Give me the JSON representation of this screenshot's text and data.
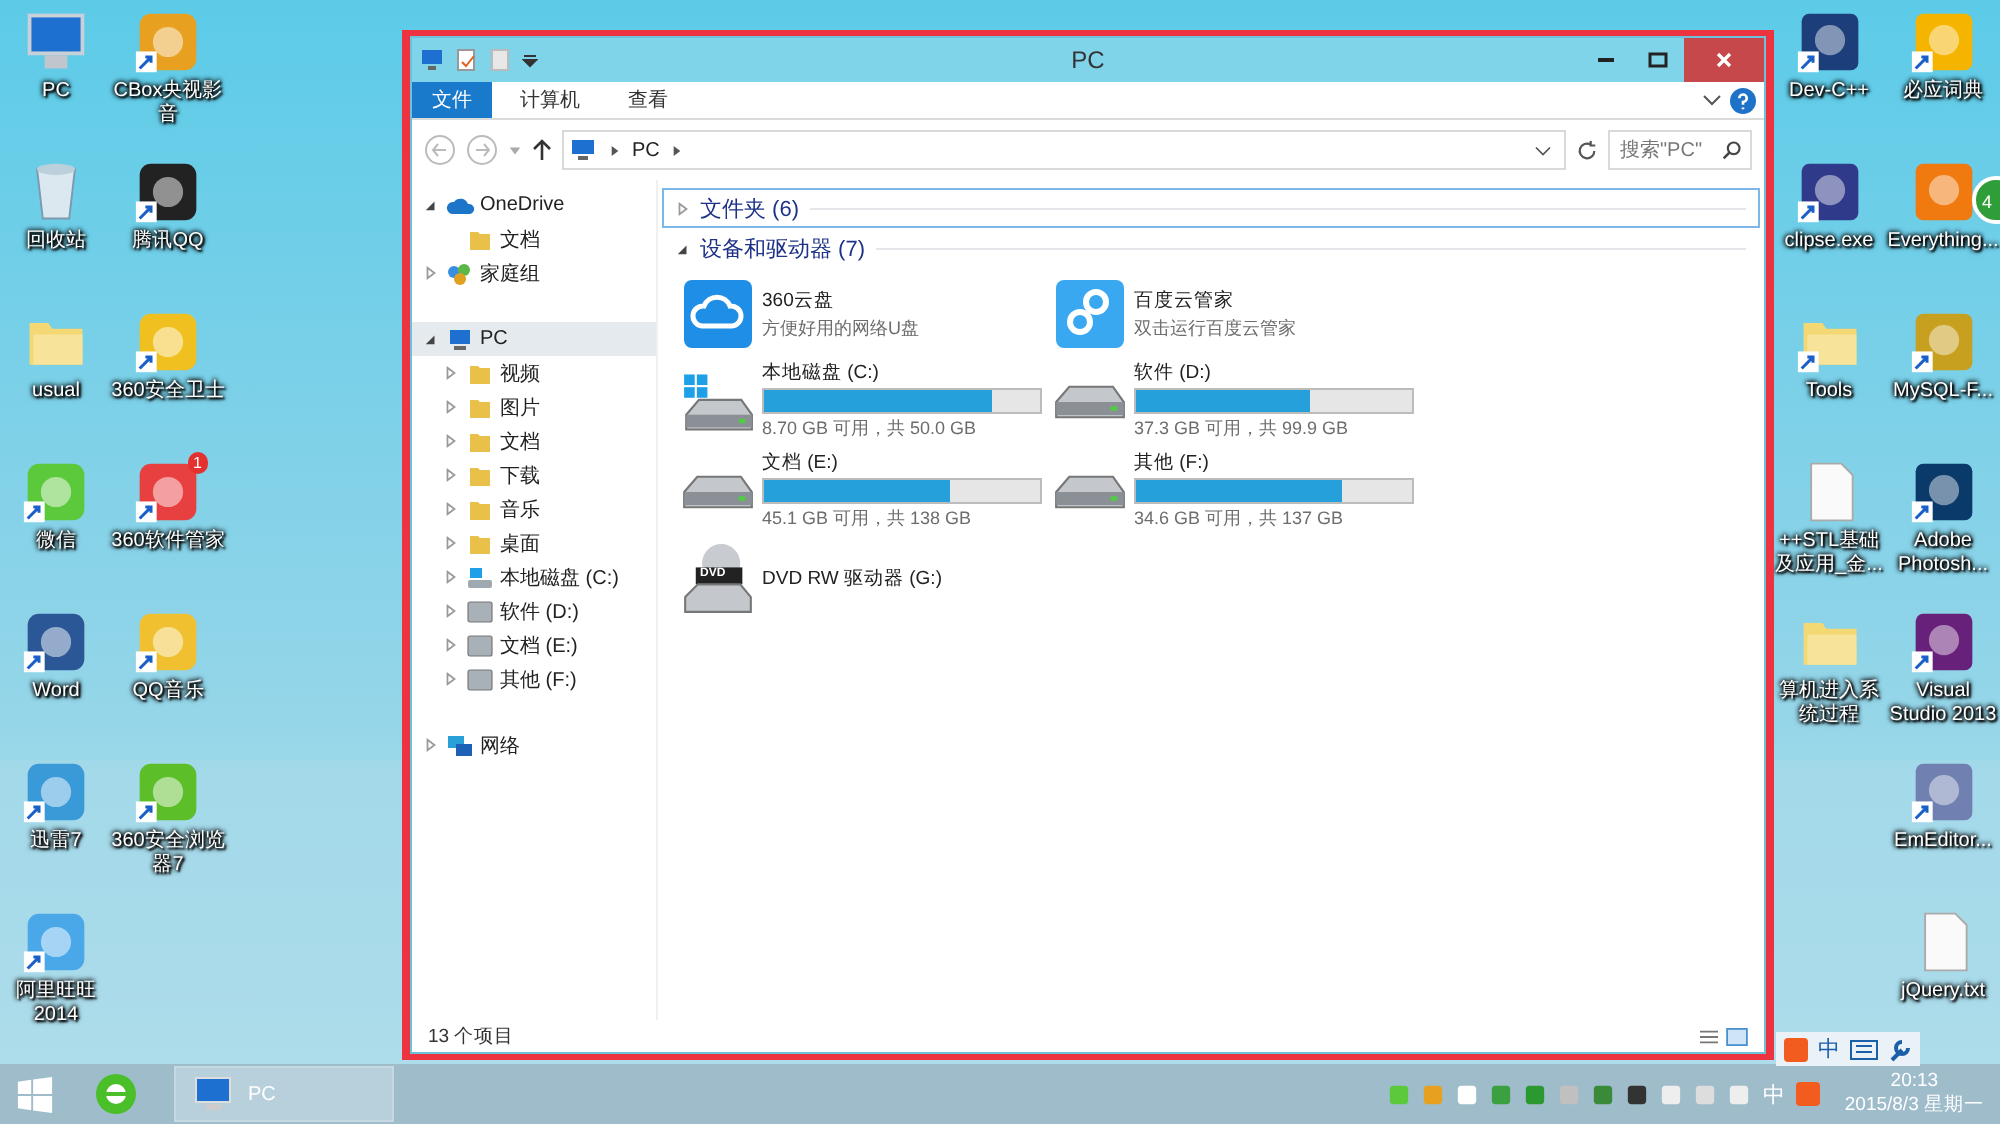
{
  "desktop": {
    "left_icons": [
      {
        "label": "PC",
        "kind": "pc",
        "shortcut": false
      },
      {
        "label": "回收站",
        "kind": "bin",
        "shortcut": false
      },
      {
        "label": "usual",
        "kind": "folder",
        "shortcut": false
      },
      {
        "label": "微信",
        "kind": "chat",
        "shortcut": true
      },
      {
        "label": "Word",
        "kind": "word",
        "shortcut": true
      },
      {
        "label": "迅雷7",
        "kind": "bird",
        "shortcut": true
      },
      {
        "label": "阿里旺旺2014",
        "kind": "bubble",
        "shortcut": true
      },
      {
        "label": "CBox央视影音",
        "kind": "video",
        "shortcut": true
      },
      {
        "label": "腾讯QQ",
        "kind": "penguin",
        "shortcut": true
      },
      {
        "label": "360安全卫士",
        "kind": "plus",
        "shortcut": true
      },
      {
        "label": "360软件管家",
        "kind": "grid",
        "shortcut": true,
        "badge": "1"
      },
      {
        "label": "QQ音乐",
        "kind": "music",
        "shortcut": true
      },
      {
        "label": "360安全浏览器7",
        "kind": "browser",
        "shortcut": true
      }
    ],
    "right_columns": [
      {
        "icons": [
          {
            "label": "Dev-C++",
            "kind": "dev",
            "shortcut": true
          },
          {
            "label": "clipse.exe",
            "kind": "sphere",
            "shortcut": true
          },
          {
            "label": "Tools",
            "kind": "folder",
            "shortcut": true
          },
          {
            "label": "++STL基础及应用_金...",
            "kind": "doc",
            "shortcut": false
          },
          {
            "label": "算机进入系统过程",
            "kind": "folder",
            "shortcut": false
          }
        ]
      },
      {
        "icons": [
          {
            "label": "必应词典",
            "kind": "book",
            "shortcut": true
          },
          {
            "label": "Everything...",
            "kind": "search-doc",
            "shortcut": false
          },
          {
            "label": "MySQL-F...",
            "kind": "database",
            "shortcut": true
          },
          {
            "label": "Adobe Photosh...",
            "kind": "ps",
            "shortcut": true
          },
          {
            "label": "Visual Studio 2013",
            "kind": "vs",
            "shortcut": true
          },
          {
            "label": "EmEditor...",
            "kind": "editor",
            "shortcut": true
          },
          {
            "label": "jQuery.txt",
            "kind": "doc",
            "shortcut": false
          }
        ]
      }
    ],
    "floating_badge": "4",
    "ime_bar": {
      "label": "中"
    }
  },
  "window": {
    "title": "PC",
    "tabs": [
      {
        "label": "文件",
        "selected": true
      },
      {
        "label": "计算机",
        "selected": false
      },
      {
        "label": "查看",
        "selected": false
      }
    ],
    "address": {
      "path": "PC"
    },
    "search": {
      "placeholder": "搜索\"PC\""
    },
    "nav": [
      {
        "label": "OneDrive",
        "kind": "cloud",
        "expandable": true,
        "expanded": true,
        "selected": false,
        "children": [
          {
            "label": "文档",
            "kind": "folder",
            "expandable": false,
            "selected": false
          }
        ]
      },
      {
        "label": "家庭组",
        "kind": "homegroup",
        "expandable": true,
        "expanded": false,
        "selected": false
      },
      {
        "label": "PC",
        "kind": "pc",
        "expandable": true,
        "expanded": true,
        "selected": true,
        "children": [
          {
            "label": "视频",
            "kind": "folder",
            "expandable": true,
            "expanded": false,
            "selected": false
          },
          {
            "label": "图片",
            "kind": "folder",
            "expandable": true,
            "expanded": false,
            "selected": false
          },
          {
            "label": "文档",
            "kind": "folder",
            "expandable": true,
            "expanded": false,
            "selected": false
          },
          {
            "label": "下载",
            "kind": "folder",
            "expandable": true,
            "expanded": false,
            "selected": false
          },
          {
            "label": "音乐",
            "kind": "folder",
            "expandable": true,
            "expanded": false,
            "selected": false
          },
          {
            "label": "桌面",
            "kind": "folder",
            "expandable": true,
            "expanded": false,
            "selected": false
          },
          {
            "label": "本地磁盘 (C:)",
            "kind": "system-drive",
            "expandable": true,
            "expanded": false,
            "selected": false
          },
          {
            "label": "软件 (D:)",
            "kind": "drive",
            "expandable": true,
            "expanded": false,
            "selected": false
          },
          {
            "label": "文档 (E:)",
            "kind": "drive",
            "expandable": true,
            "expanded": false,
            "selected": false
          },
          {
            "label": "其他 (F:)",
            "kind": "drive",
            "expandable": true,
            "expanded": false,
            "selected": false
          }
        ]
      },
      {
        "label": "网络",
        "kind": "network",
        "expandable": true,
        "expanded": false,
        "selected": false
      }
    ],
    "groups": [
      {
        "title": "文件夹 (6)",
        "expanded": false,
        "selected": true
      },
      {
        "title": "设备和驱动器 (7)",
        "expanded": true,
        "selected": false,
        "items": [
          {
            "kind": "cloud-app",
            "name": "360云盘",
            "subtitle": "方便好用的网络U盘"
          },
          {
            "kind": "link-app",
            "name": "百度云管家",
            "subtitle": "双击运行百度云管家"
          },
          {
            "kind": "drive",
            "name": "本地磁盘 (C:)",
            "system": true,
            "level": 0.826,
            "free": "8.70 GB 可用，共 50.0 GB"
          },
          {
            "kind": "drive",
            "name": "软件 (D:)",
            "system": false,
            "level": 0.627,
            "free": "37.3 GB 可用，共 99.9 GB"
          },
          {
            "kind": "drive",
            "name": "文档 (E:)",
            "system": false,
            "level": 0.673,
            "free": "45.1 GB 可用，共 138 GB"
          },
          {
            "kind": "drive",
            "name": "其他 (F:)",
            "system": false,
            "level": 0.747,
            "free": "34.6 GB 可用，共 137 GB"
          },
          {
            "kind": "dvd",
            "name": "DVD RW 驱动器 (G:)",
            "badge": "DVD"
          }
        ]
      }
    ],
    "status_bar": {
      "text": "13 个项目"
    }
  },
  "taskbar": {
    "buttons": [
      {
        "label": "PC",
        "kind": "pc",
        "active": true
      }
    ],
    "input_mode": "中",
    "time": "20:13",
    "date": "2015/8/3 星期一"
  }
}
